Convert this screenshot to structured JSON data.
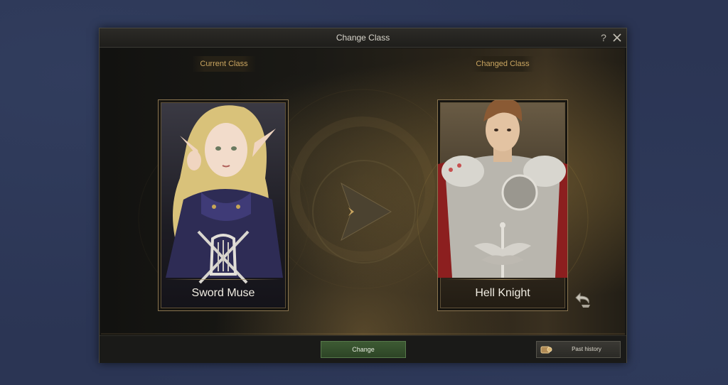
{
  "dialog": {
    "title": "Change Class",
    "help_label": "?"
  },
  "current_class": {
    "label": "Current Class",
    "name": "Sword Muse",
    "emblem": "lyre-and-crossed-swords-emblem"
  },
  "changed_class": {
    "label": "Changed Class",
    "name": "Hell Knight",
    "emblem": "winged-sword-emblem"
  },
  "footer": {
    "change_label": "Change",
    "history_label": "Past history"
  },
  "colors": {
    "accent_gold": "#c9a560",
    "change_button": "#3d5a33"
  },
  "icons": {
    "help": "question-mark-icon",
    "close": "close-icon",
    "arrow": "play-arrow-icon",
    "undo": "undo-arrow-icon",
    "history": "scroll-icon"
  }
}
